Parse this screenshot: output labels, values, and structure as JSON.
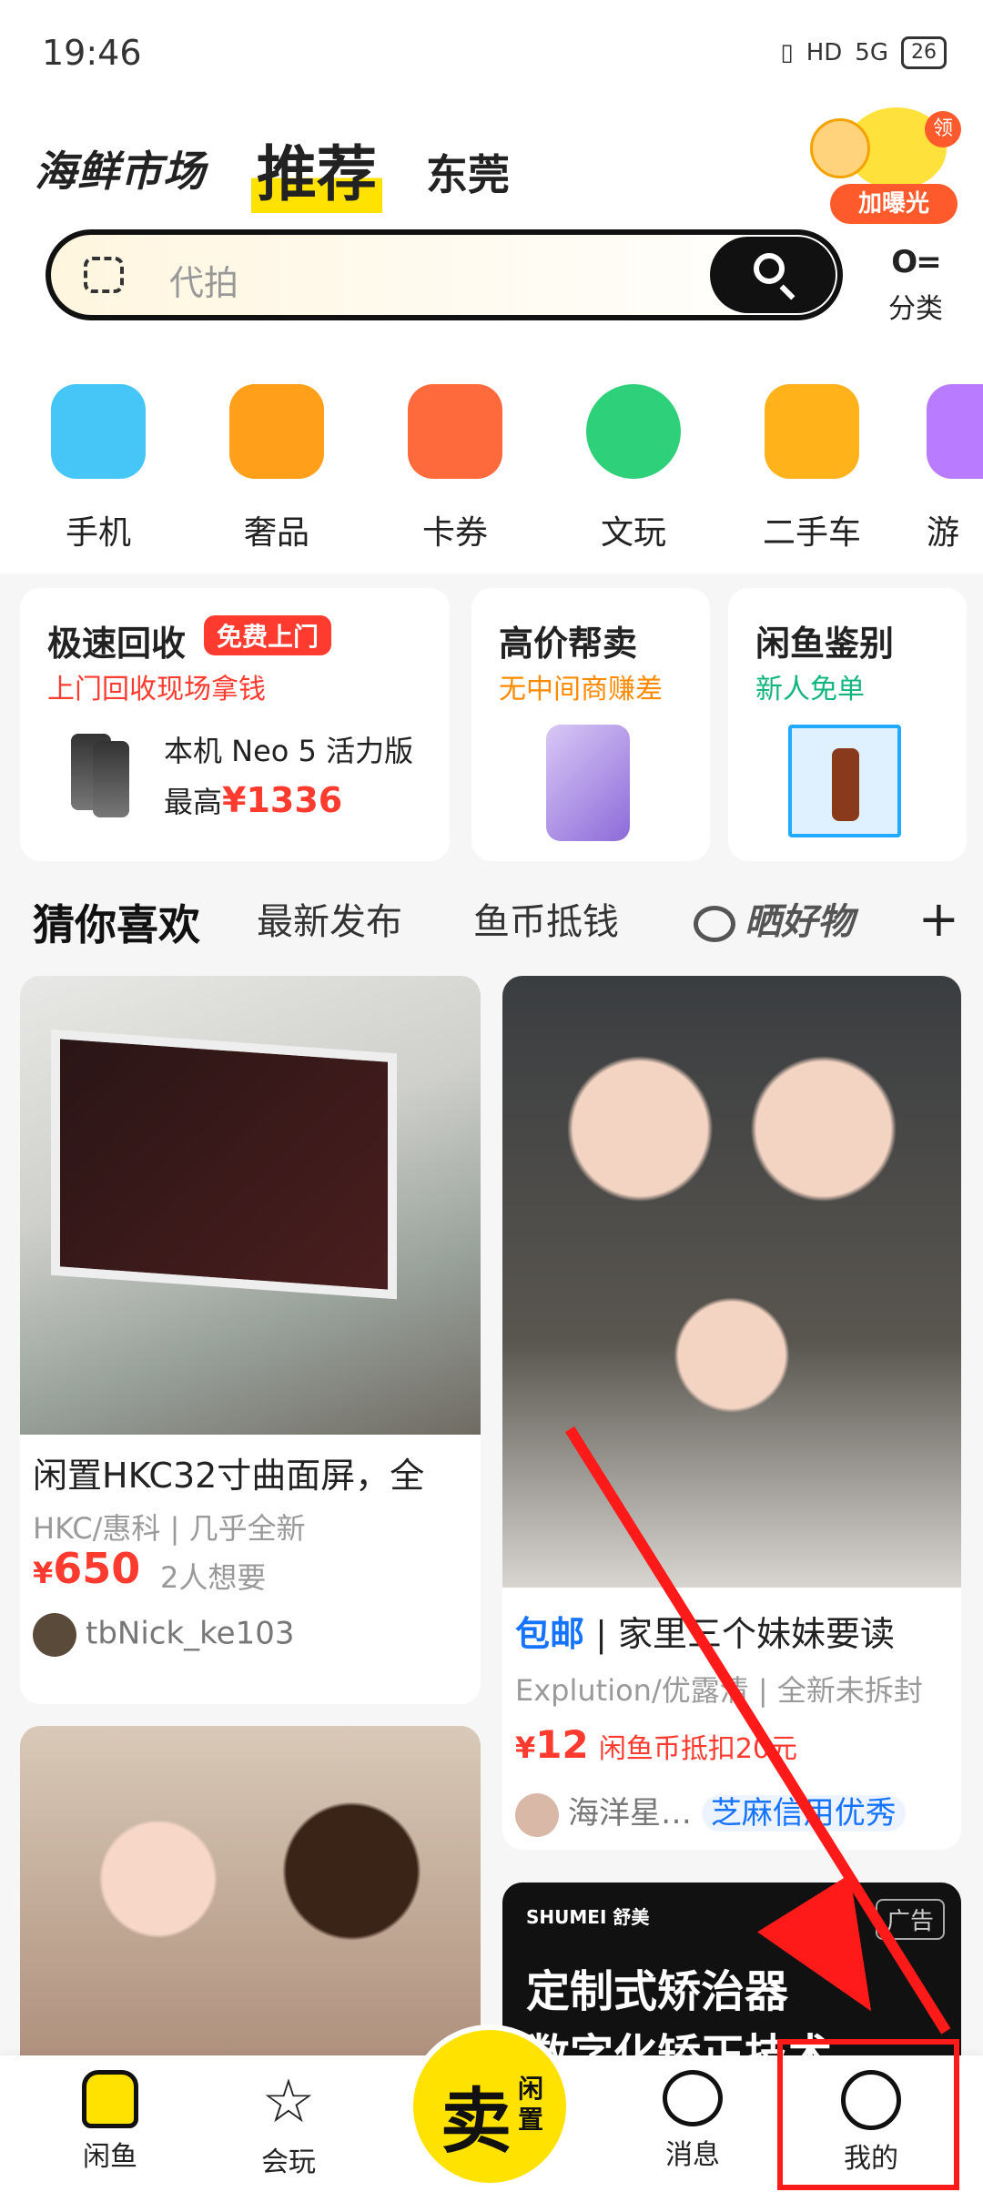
{
  "status": {
    "time": "19:46",
    "hd": "HD",
    "net": "5G",
    "battery": "26"
  },
  "header": {
    "brand": "海鲜市场",
    "tab_active": "推荐",
    "city": "东莞",
    "promo_badge": "领",
    "promo_label": "加曝光"
  },
  "search": {
    "placeholder": "代拍"
  },
  "category": {
    "icon": "O=",
    "label": "分类"
  },
  "quick_links": [
    {
      "label": "手机",
      "icon": "phone-icon",
      "color": "#45c6f7"
    },
    {
      "label": "奢品",
      "icon": "handbag-icon",
      "color": "#ff9f1a"
    },
    {
      "label": "卡券",
      "icon": "coupon-icon",
      "color": "#ff6a3d"
    },
    {
      "label": "文玩",
      "icon": "bead-icon",
      "color": "#2fd07a"
    },
    {
      "label": "二手车",
      "icon": "car-icon",
      "color": "#ffb21a"
    },
    {
      "label": "游",
      "icon": "game-icon",
      "color": "#b97bff"
    }
  ],
  "service_cards": [
    {
      "title": "极速回收",
      "badge": "免费上门",
      "subtitle": "上门回收现场拿钱",
      "subtitle_color": "#ff3b30",
      "product": "本机 Neo 5 活力版",
      "price_prefix": "最高",
      "price": "¥1336"
    },
    {
      "title": "高价帮卖",
      "subtitle": "无中间商赚差",
      "subtitle_color": "#ff8a00"
    },
    {
      "title": "闲鱼鉴别",
      "subtitle": "新人免单",
      "subtitle_color": "#12b57d"
    }
  ],
  "feed_tabs": [
    "猜你喜欢",
    "最新发布",
    "鱼币抵钱",
    "晒好物"
  ],
  "items": [
    {
      "title": "闲置HKC32寸曲面屏，全",
      "brand": "HKC/惠科",
      "condition": "几乎全新",
      "price_symbol": "¥",
      "price": "650",
      "wants": "2人想要",
      "user": "tbNick_ke103"
    },
    {
      "tag": "包邮",
      "title": "家里三个妹妹要读",
      "brand": "Explution/优露清",
      "condition": "全新未拆封",
      "price_symbol": "¥",
      "price": "12",
      "coin_note": "闲鱼币抵扣20元",
      "user": "海洋星…",
      "credit": "芝麻信用优秀"
    }
  ],
  "ad": {
    "brand": "SHUMEI 舒美",
    "tag": "广告",
    "line1": "定制式矫治器",
    "line2": "数字化矫正技术"
  },
  "tabbar": [
    {
      "label": "闲鱼"
    },
    {
      "label": "会玩"
    },
    {
      "label": "消息"
    },
    {
      "label": "我的"
    }
  ],
  "sell_button": {
    "big": "卖",
    "small": "闲置"
  },
  "colors": {
    "accent": "#ffe200",
    "price": "#ff3b30",
    "annotation": "#ff1a1a"
  }
}
